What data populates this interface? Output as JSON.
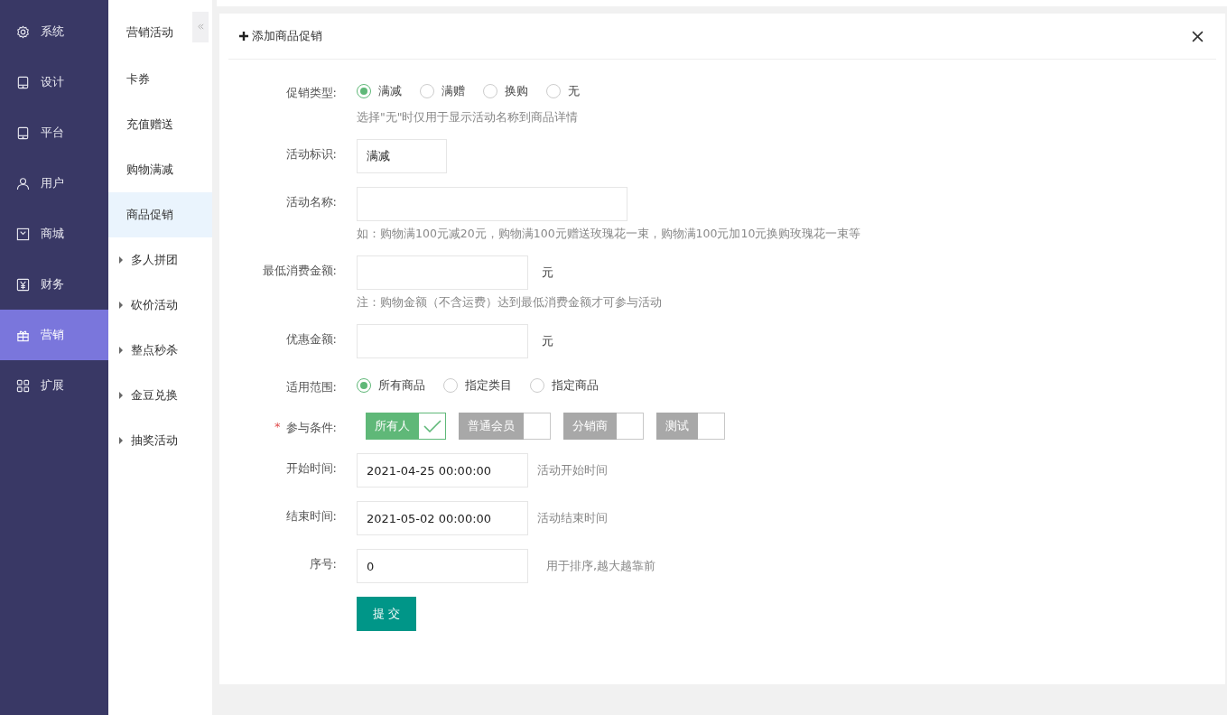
{
  "main_menu": [
    {
      "label": "系统",
      "selected": false
    },
    {
      "label": "设计",
      "selected": false
    },
    {
      "label": "平台",
      "selected": false
    },
    {
      "label": "用户",
      "selected": false
    },
    {
      "label": "商城",
      "selected": false
    },
    {
      "label": "财务",
      "selected": false
    },
    {
      "label": "营销",
      "selected": true
    },
    {
      "label": "扩展",
      "selected": false
    }
  ],
  "sub_menu": {
    "title": "营销活动",
    "items": [
      {
        "label": "卡券",
        "expandable": false,
        "selected": false
      },
      {
        "label": "充值赠送",
        "expandable": false,
        "selected": false
      },
      {
        "label": "购物满减",
        "expandable": false,
        "selected": false
      },
      {
        "label": "商品促销",
        "expandable": false,
        "selected": true
      },
      {
        "label": "多人拼团",
        "expandable": true,
        "selected": false
      },
      {
        "label": "砍价活动",
        "expandable": true,
        "selected": false
      },
      {
        "label": "整点秒杀",
        "expandable": true,
        "selected": false
      },
      {
        "label": "金豆兑换",
        "expandable": true,
        "selected": false
      },
      {
        "label": "抽奖活动",
        "expandable": true,
        "selected": false
      }
    ]
  },
  "panel": {
    "title": "添加商品促销"
  },
  "form": [
    {
      "kind": "radio",
      "label": "促销类型:",
      "options": [
        {
          "label": "满减",
          "selected": true
        },
        {
          "label": "满赠",
          "selected": false
        },
        {
          "label": "换购",
          "selected": false
        },
        {
          "label": "无",
          "selected": false
        }
      ],
      "hint": "选择\"无\"时仅用于显示活动名称到商品详情"
    },
    {
      "kind": "input",
      "label": "活动标识:",
      "value": "满减"
    },
    {
      "kind": "input",
      "label": "活动名称:",
      "hint": "如：购物满100元减20元，购物满100元赠送玫瑰花一束，购物满100元加10元换购玫瑰花一束等"
    },
    {
      "kind": "input",
      "label": "最低消费金额:",
      "unit": "元",
      "hint": "注：购物金额（不含运费）达到最低消费金额才可参与活动"
    },
    {
      "kind": "input",
      "label": "优惠金额:",
      "unit": "元"
    },
    {
      "kind": "radio",
      "label": "适用范围:",
      "options": [
        {
          "label": "所有商品",
          "selected": true
        },
        {
          "label": "指定类目",
          "selected": false
        },
        {
          "label": "指定商品",
          "selected": false
        }
      ]
    },
    {
      "kind": "checks",
      "label": "参与条件:",
      "required_mark": "*",
      "options": [
        {
          "label": "所有人",
          "checked": true
        },
        {
          "label": "普通会员",
          "checked": false
        },
        {
          "label": "分销商",
          "checked": false
        },
        {
          "label": "测试",
          "checked": false
        }
      ]
    },
    {
      "kind": "input",
      "label": "开始时间:",
      "value": "2021-04-25 00:00:00",
      "aside": "活动开始时间"
    },
    {
      "kind": "input",
      "label": "结束时间:",
      "value": "2021-05-02 00:00:00",
      "aside": "活动结束时间"
    },
    {
      "kind": "input",
      "label": "序号:",
      "value": "0",
      "aside": "用于排序,越大越靠前"
    }
  ],
  "submit": "提 交"
}
